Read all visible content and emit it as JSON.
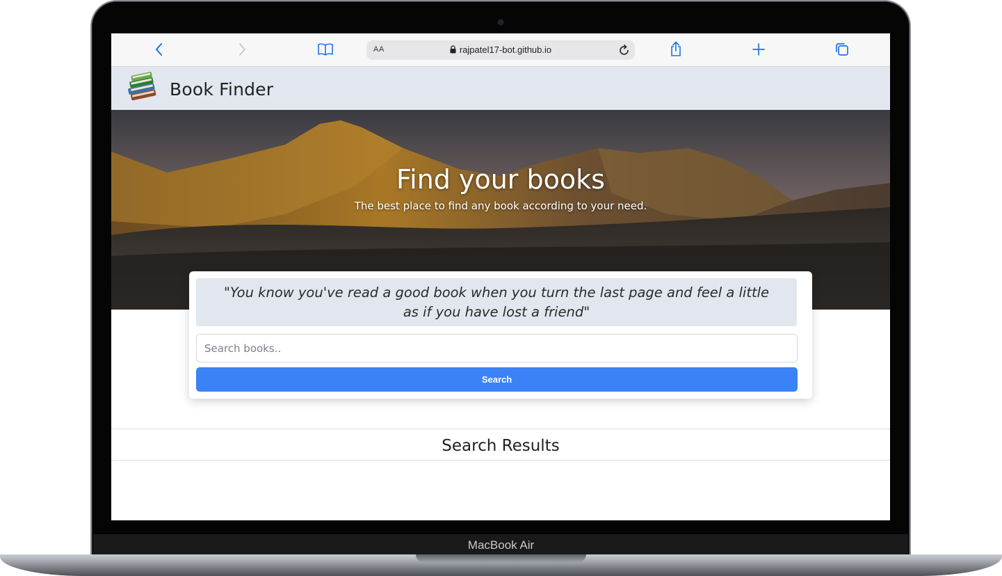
{
  "device": {
    "model_label": "MacBook Air"
  },
  "browser": {
    "reader_label": "AA",
    "url": "rajpatel17-bot.github.io",
    "icons": {
      "back": "chevron-left-icon",
      "forward": "chevron-right-icon",
      "bookmarks": "book-open-icon",
      "lock": "lock-icon",
      "reload": "reload-icon",
      "share": "share-icon",
      "new_tab": "plus-icon",
      "tabs": "tabs-icon"
    }
  },
  "header": {
    "logo": "books-stack-icon",
    "title": "Book Finder"
  },
  "hero": {
    "title": "Find your books",
    "subtitle": "The best place to find any book according to your need."
  },
  "search": {
    "quote": "\"You know you've read a good book when you turn the last page and feel a little as if you have lost a friend\"",
    "placeholder": "Search books..",
    "value": "",
    "button_label": "Search"
  },
  "results": {
    "title": "Search Results"
  },
  "colors": {
    "header_bg": "#e2e7ef",
    "button_bg": "#3b82f6",
    "safari_accent": "#1a73e8"
  }
}
